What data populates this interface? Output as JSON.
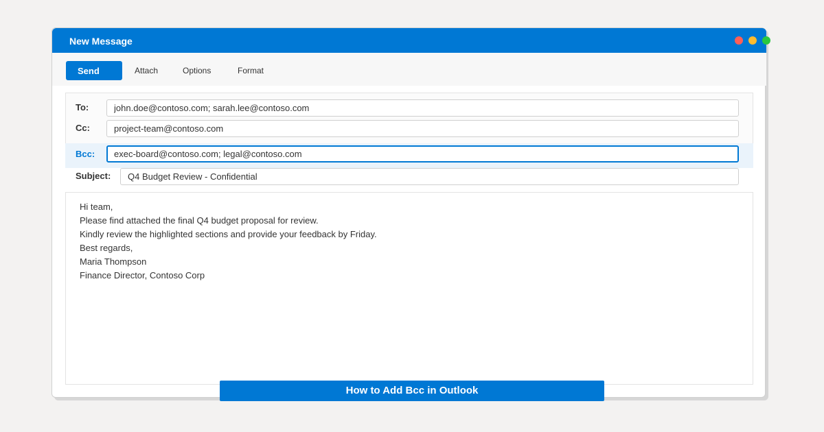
{
  "window": {
    "title": "New Message",
    "controls": {
      "close_color": "#ff5f57",
      "minimize_color": "#febc2e",
      "maximize_color": "#28c840"
    }
  },
  "toolbar": {
    "send_label": "Send",
    "attach_label": "Attach",
    "options_label": "Options",
    "format_label": "Format"
  },
  "fields": {
    "to": {
      "label": "To:",
      "value": "john.doe@contoso.com; sarah.lee@contoso.com"
    },
    "cc": {
      "label": "Cc:",
      "value": "project-team@contoso.com"
    },
    "bcc": {
      "label": "Bcc:",
      "value": "exec-board@contoso.com; legal@contoso.com"
    },
    "subject": {
      "label": "Subject:",
      "value": "Q4 Budget Review - Confidential"
    }
  },
  "body": {
    "lines": [
      "Hi team,",
      "Please find attached the final Q4 budget proposal for review.",
      "Kindly review the highlighted sections and provide your feedback by Friday.",
      "Best regards,",
      "Maria Thompson",
      "Finance Director, Contoso Corp"
    ]
  },
  "caption": "How to Add Bcc in Outlook",
  "colors": {
    "accent": "#0078d4",
    "bcc_highlight": "#eaf3fb"
  }
}
